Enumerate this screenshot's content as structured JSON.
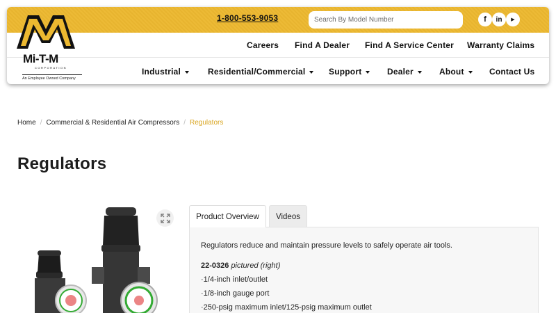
{
  "header": {
    "phone": "1-800-553-9053",
    "search_placeholder": "Search By Model Number",
    "social": [
      {
        "icon": "facebook-icon",
        "glyph": "f"
      },
      {
        "icon": "linkedin-icon",
        "glyph": "in"
      },
      {
        "icon": "youtube-icon",
        "glyph": "▶"
      }
    ],
    "top_links": [
      "Careers",
      "Find A Dealer",
      "Find A Service Center",
      "Warranty Claims"
    ],
    "main_nav": [
      "Industrial",
      "Residential/Commercial",
      "Support",
      "Dealer",
      "About",
      "Contact Us"
    ],
    "accent_color": "#ecb830"
  },
  "logo": {
    "name": "Mi-T-M",
    "sub": "CORPORATION",
    "tagline": "An Employee Owned Company"
  },
  "breadcrumb": {
    "home": "Home",
    "category": "Commercial & Residential Air Compressors",
    "current": "Regulators"
  },
  "page": {
    "title": "Regulators"
  },
  "tabs": {
    "overview": "Product Overview",
    "videos": "Videos"
  },
  "overview": {
    "intro": "Regulators reduce and maintain pressure levels to safely operate air tools.",
    "model": "22-0326",
    "model_note": "pictured (right)",
    "bullets": [
      "·1/4-inch inlet/outlet",
      "·1/8-inch gauge port",
      "·250-psig maximum inlet/125-psig maximum outlet"
    ]
  }
}
